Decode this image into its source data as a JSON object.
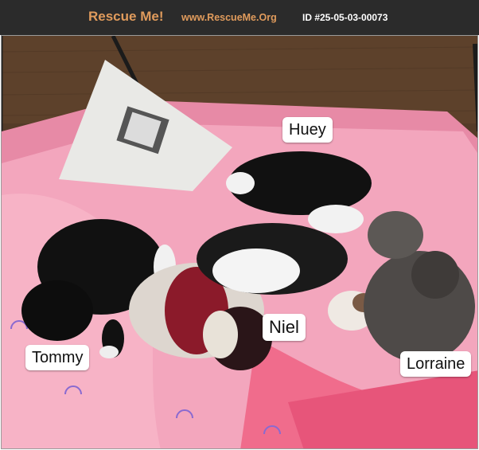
{
  "header": {
    "brand": "Rescue Me!",
    "site": "www.RescueMe.Org",
    "id_text": "ID #25-05-03-00073"
  },
  "photo": {
    "labels": {
      "huey": "Huey",
      "tommy": "Tommy",
      "niel": "Niel",
      "lorraine": "Lorraine"
    }
  },
  "colors": {
    "header_bg": "#2b2b2b",
    "brand": "#e09b5c",
    "blanket": "#f3a6bd"
  }
}
